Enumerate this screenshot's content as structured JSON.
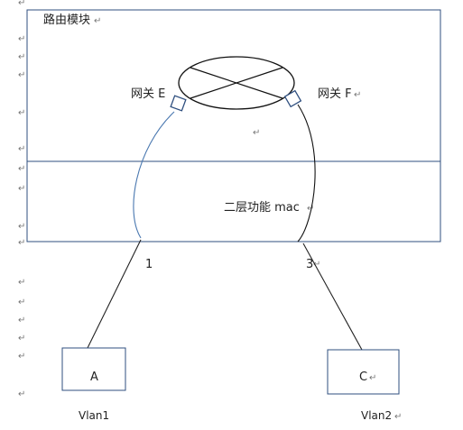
{
  "colors": {
    "outline": "#2f4f7f",
    "line": "#222222",
    "link_e": "#4a78b0",
    "link_f": "#111111",
    "paragraph_mark": "#777777"
  },
  "labels": {
    "routing_module": "路由模块",
    "gateway_e": "网关 E",
    "gateway_f": "网关 F",
    "layer2": "二层功能  mac",
    "port_1": "1",
    "port_3": "3",
    "host_a": "A",
    "host_c": "C",
    "vlan_a": "Vlan1",
    "vlan_c": "Vlan2"
  },
  "icons": {
    "router": "router-icon",
    "paragraph_mark": "↵"
  }
}
